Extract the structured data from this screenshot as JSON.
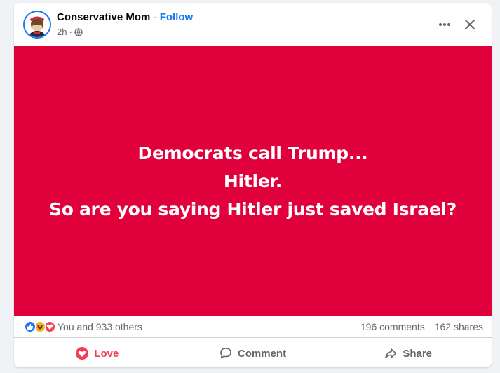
{
  "post": {
    "author": "Conservative Mom",
    "separator": "·",
    "follow_label": "Follow",
    "time": "2h",
    "time_separator": "·",
    "privacy_icon": "globe-icon",
    "image_text": [
      "Democrats call Trump...",
      "Hitler.",
      "So are you saying Hitler just saved Israel?"
    ],
    "image_background": "#e0003c"
  },
  "header_actions": {
    "more_icon": "more-dots-icon",
    "close_icon": "close-icon"
  },
  "stats": {
    "reactions_text": "You and 933 others",
    "reaction_icons": [
      "like-icon",
      "haha-icon",
      "love-icon"
    ],
    "comments": "196 comments",
    "shares": "162 shares"
  },
  "actions": [
    {
      "label": "Love",
      "icon": "love-icon",
      "active": true
    },
    {
      "label": "Comment",
      "icon": "comment-icon"
    },
    {
      "label": "Share",
      "icon": "share-icon"
    }
  ],
  "colors": {
    "accent": "#1877f2",
    "love": "#f33e58",
    "muted": "#65676b"
  }
}
